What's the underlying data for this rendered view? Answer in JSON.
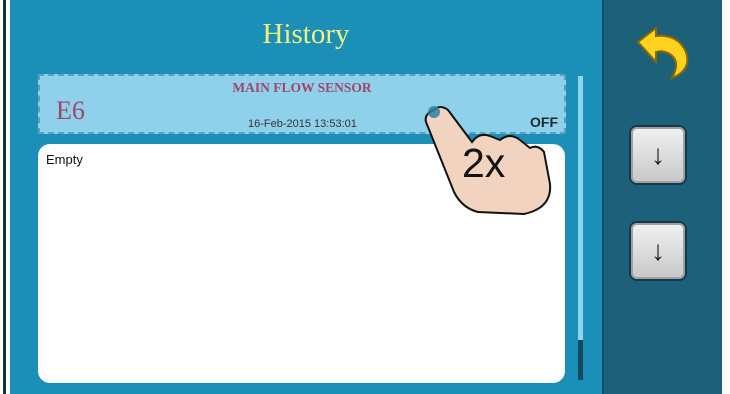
{
  "header": {
    "title": "History"
  },
  "event": {
    "code": "E6",
    "name": "MAIN FLOW SENSOR",
    "timestamp": "16-Feb-2015 13:53:01",
    "state": "OFF"
  },
  "details": {
    "text": "Empty"
  },
  "gesture": {
    "label": "2x"
  },
  "sidebar": {
    "down_label": "↓"
  },
  "colors": {
    "screen_bg": "#1b8fb8",
    "side_panel": "#1c607a",
    "title": "#f4f07a",
    "event_bg": "#8fd0ea",
    "event_text": "#a0466a"
  }
}
